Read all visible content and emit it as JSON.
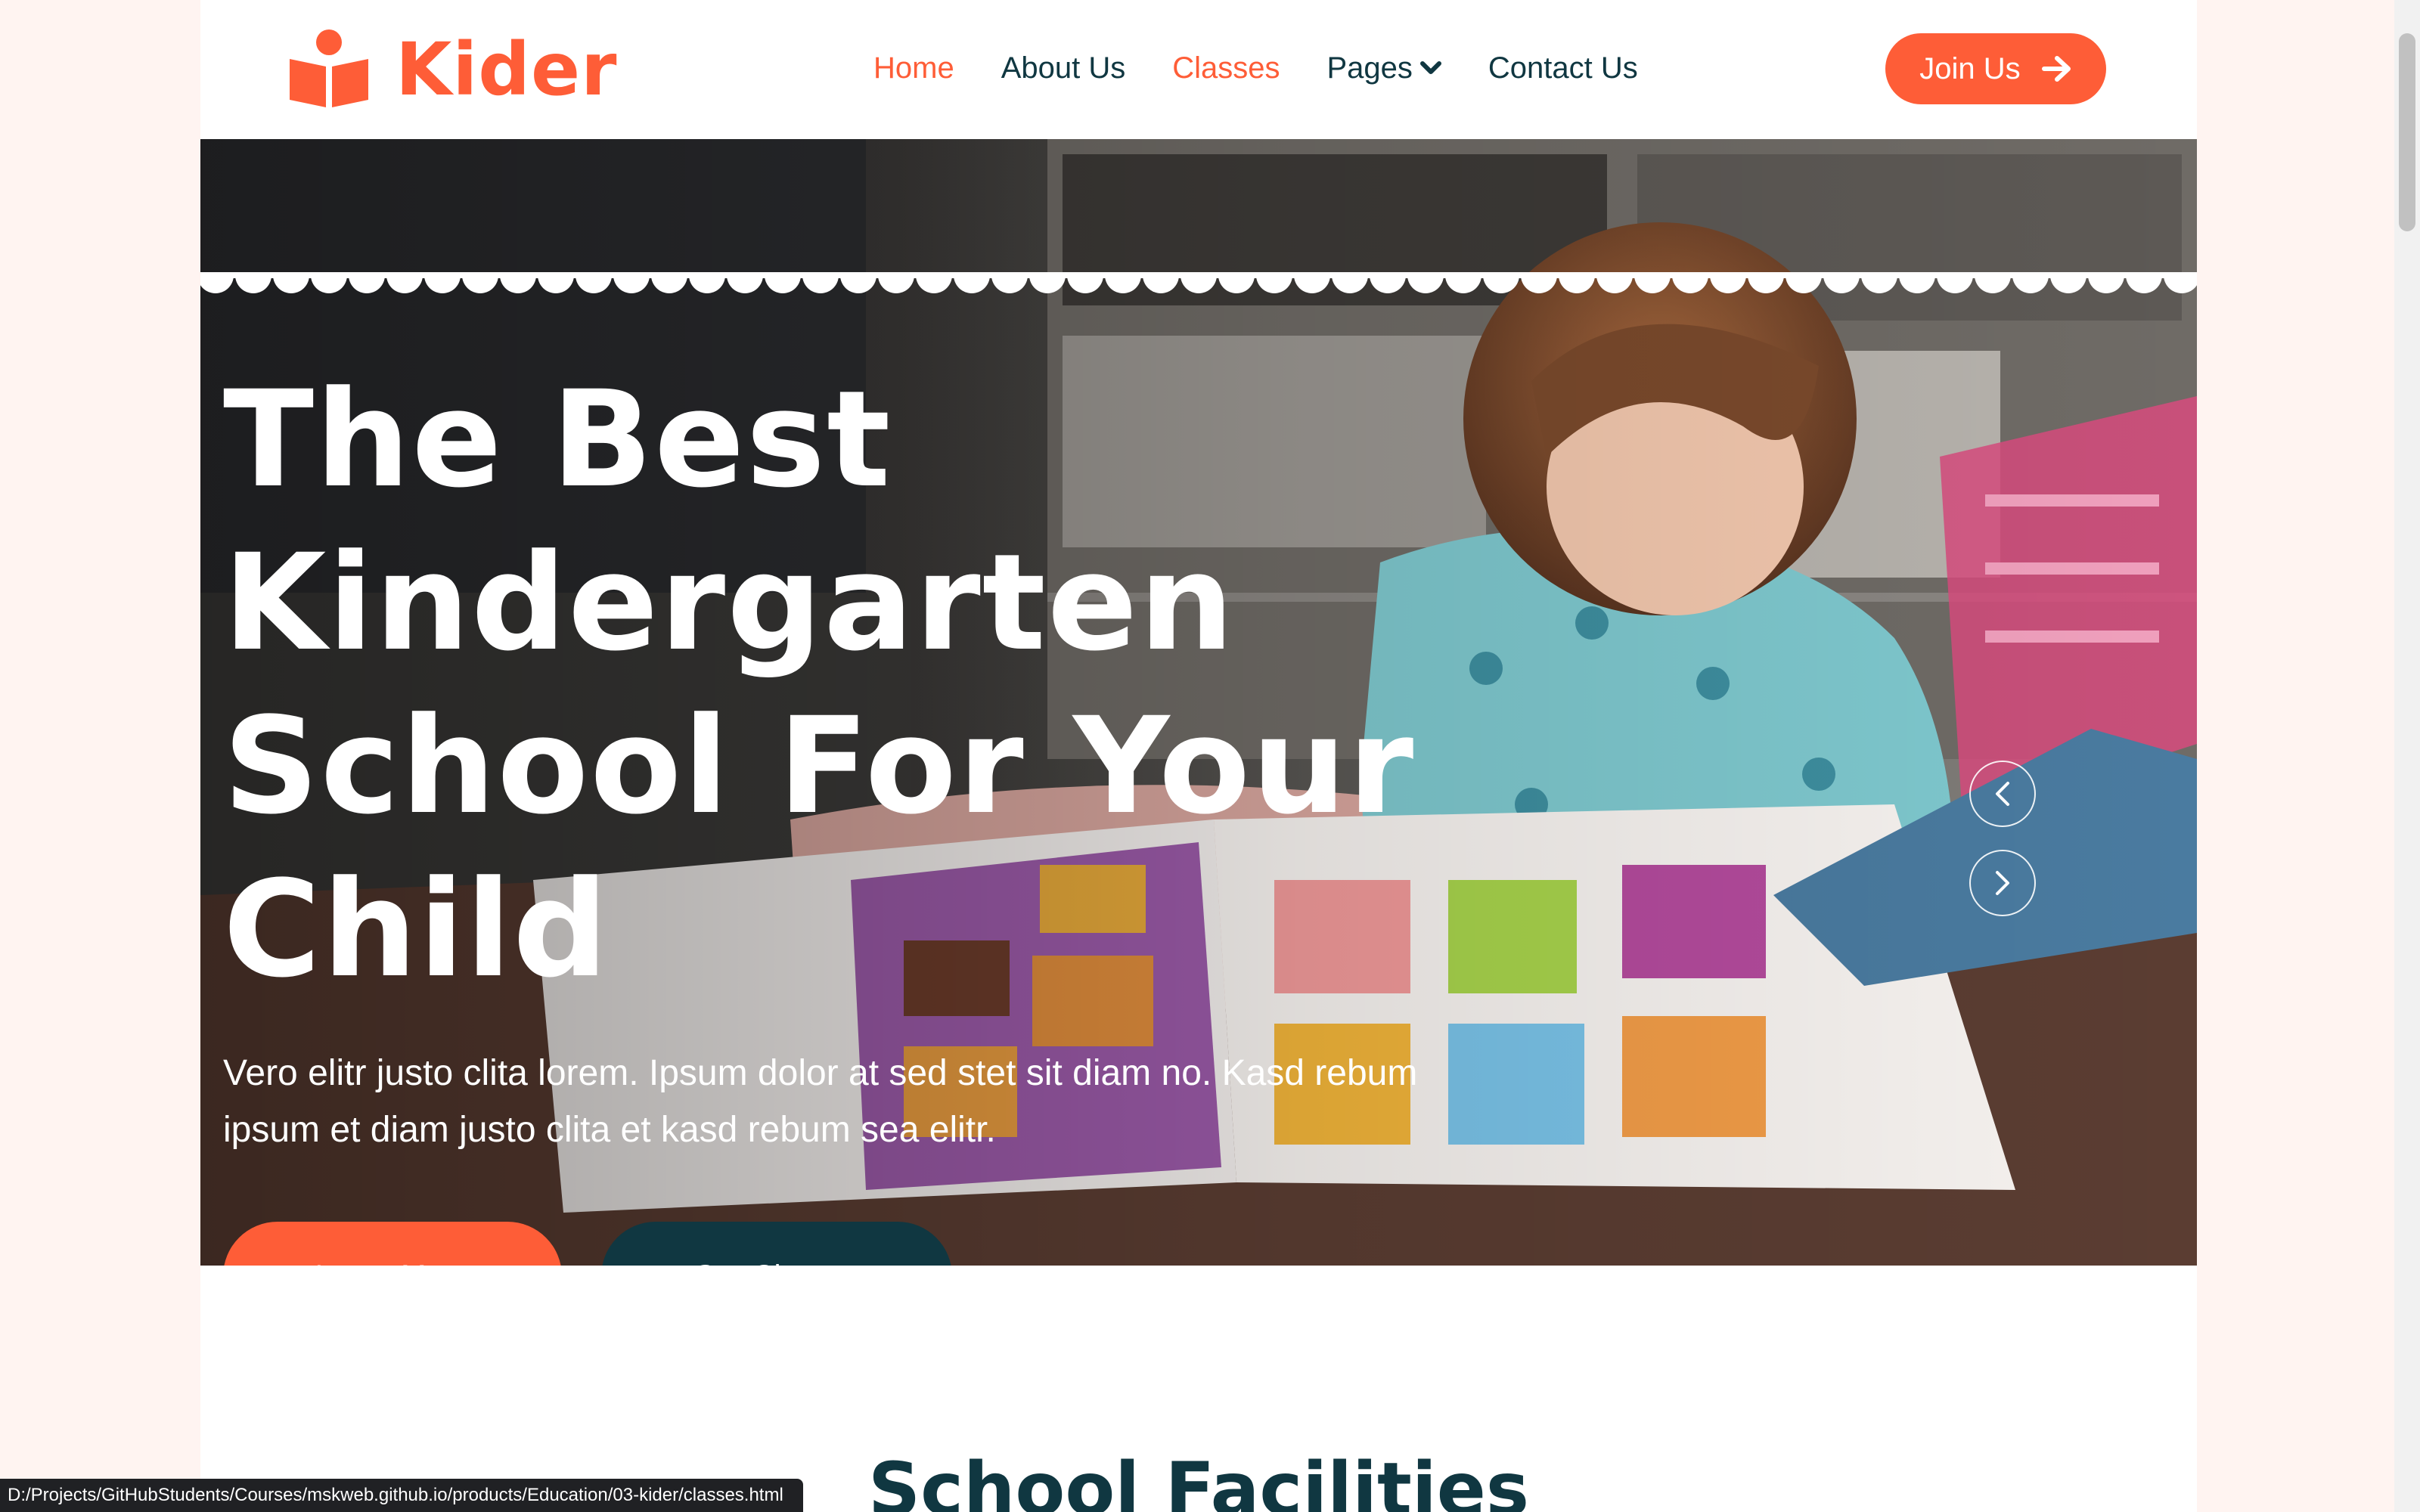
{
  "brand": {
    "name": "Kider",
    "icon": "book-reader-icon"
  },
  "nav": {
    "items": [
      {
        "label": "Home"
      },
      {
        "label": "About Us"
      },
      {
        "label": "Classes"
      },
      {
        "label": "Pages"
      },
      {
        "label": "Contact Us"
      }
    ],
    "active": "Home",
    "hovered": "Classes"
  },
  "join": {
    "label": "Join Us",
    "icon": "arrow-right-icon"
  },
  "hero": {
    "title": "The Best Kindergarten School For Your Child",
    "description": "Vero elitr justo clita lorem. Ipsum dolor at sed stet sit diam no. Kasd rebum ipsum et diam justo clita et kasd rebum sea elitr.",
    "learn_more": "Learn More",
    "our_classes": "Our Classes",
    "image": "child-reading-picture-book-photo"
  },
  "section": {
    "title": "School Facilities"
  },
  "status_bar": {
    "url": "D:/Projects/GitHubStudents/Courses/mskweb.github.io/products/Education/03-kider/classes.html"
  },
  "colors": {
    "primary": "#fe5d37",
    "dark": "#103741",
    "page_bg": "#fff4f1",
    "white": "#ffffff"
  }
}
